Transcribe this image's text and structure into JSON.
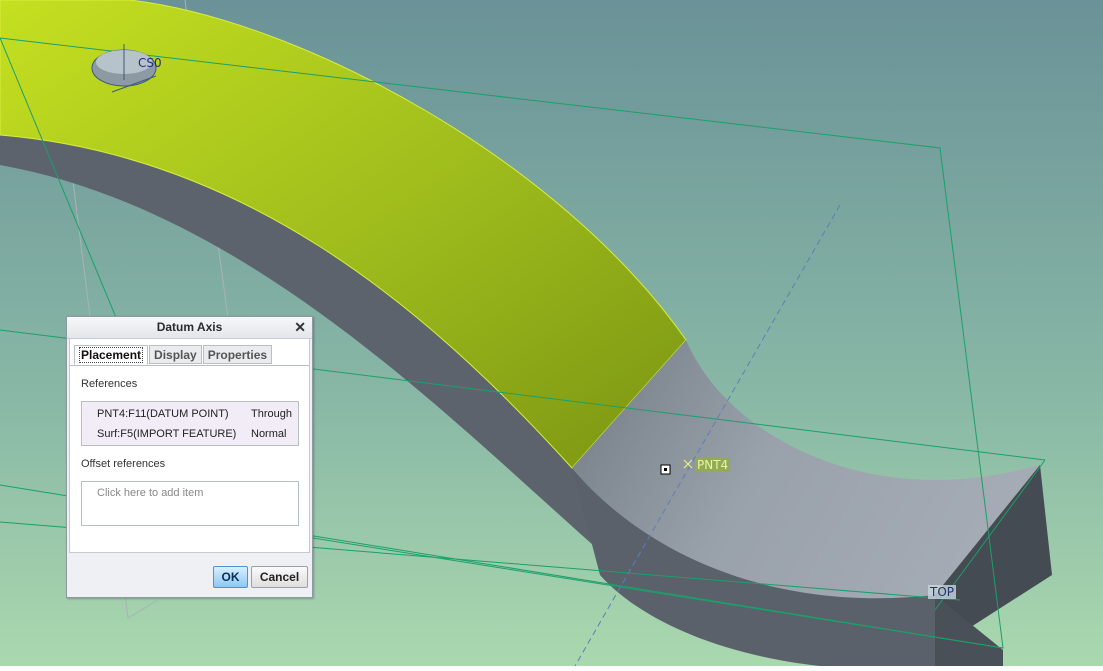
{
  "viewport": {
    "labels": {
      "pnt4": "PNT4",
      "top": "TOP",
      "csc": "CS0"
    },
    "colors": {
      "background_top": "#6b9498",
      "background_bottom": "#a9d7ad",
      "surface_yellow": "#a8c21c",
      "datum_plane": "#19a26a"
    }
  },
  "dialog": {
    "title": "Datum Axis",
    "close_icon": "close-icon",
    "tabs": [
      {
        "label": "Placement",
        "active": true
      },
      {
        "label": "Display",
        "active": false
      },
      {
        "label": "Properties",
        "active": false
      }
    ],
    "references": {
      "label": "References",
      "rows": [
        {
          "name": "PNT4:F11(DATUM POINT)",
          "type": "Through"
        },
        {
          "name": "Surf:F5(IMPORT FEATURE)",
          "type": "Normal"
        }
      ]
    },
    "offset": {
      "label": "Offset references",
      "placeholder": "Click here to add item"
    },
    "buttons": {
      "ok": "OK",
      "cancel": "Cancel"
    }
  }
}
